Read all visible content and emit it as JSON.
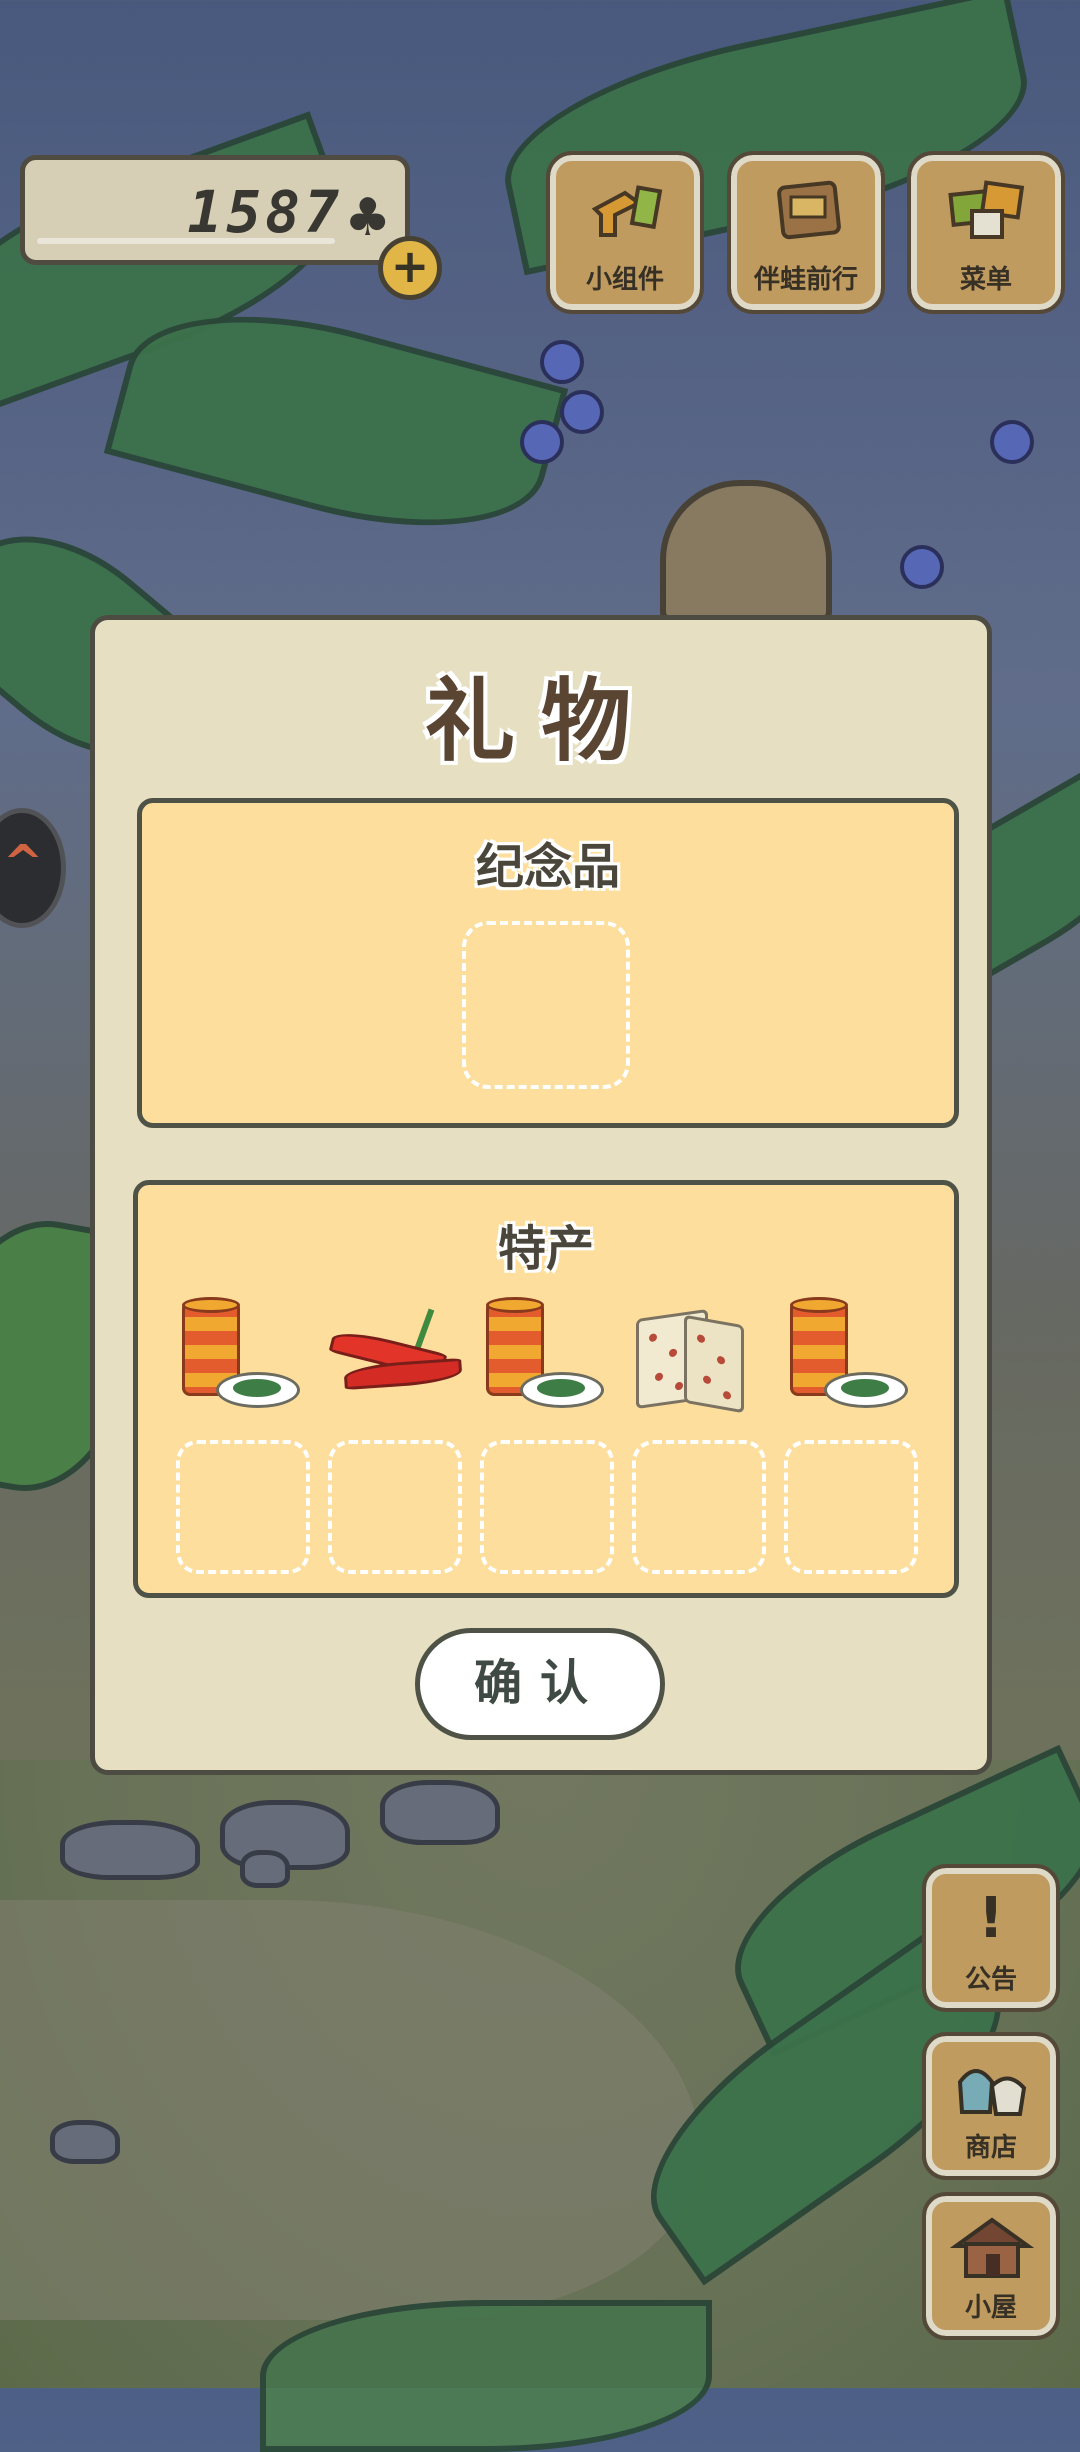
{
  "currency": {
    "amount": "1587",
    "icon": "clover-icon",
    "add_icon": "plus-icon"
  },
  "top_buttons": [
    {
      "label": "小组件",
      "icon": "widget-icon"
    },
    {
      "label": "伴蛙前行",
      "icon": "journal-icon"
    },
    {
      "label": "菜单",
      "icon": "menu-icon"
    }
  ],
  "side_buttons": [
    {
      "label": "公告",
      "icon": "exclamation-icon"
    },
    {
      "label": "商店",
      "icon": "shop-bag-icon"
    },
    {
      "label": "小屋",
      "icon": "house-icon"
    }
  ],
  "dialog": {
    "title": "礼物",
    "souvenir": {
      "title": "纪念品"
    },
    "specialty": {
      "title": "特产",
      "items": [
        {
          "icon": "canned-food-icon"
        },
        {
          "icon": "chili-pepper-icon"
        },
        {
          "icon": "canned-food-icon"
        },
        {
          "icon": "nougat-icon"
        },
        {
          "icon": "canned-food-icon"
        }
      ]
    },
    "confirm_label": "确认"
  },
  "colors": {
    "dialog_bg": "#e6dfc1",
    "panel_bg": "#fede9d",
    "button_wood": "#cfa667",
    "coin_accent": "#f2c44b"
  }
}
